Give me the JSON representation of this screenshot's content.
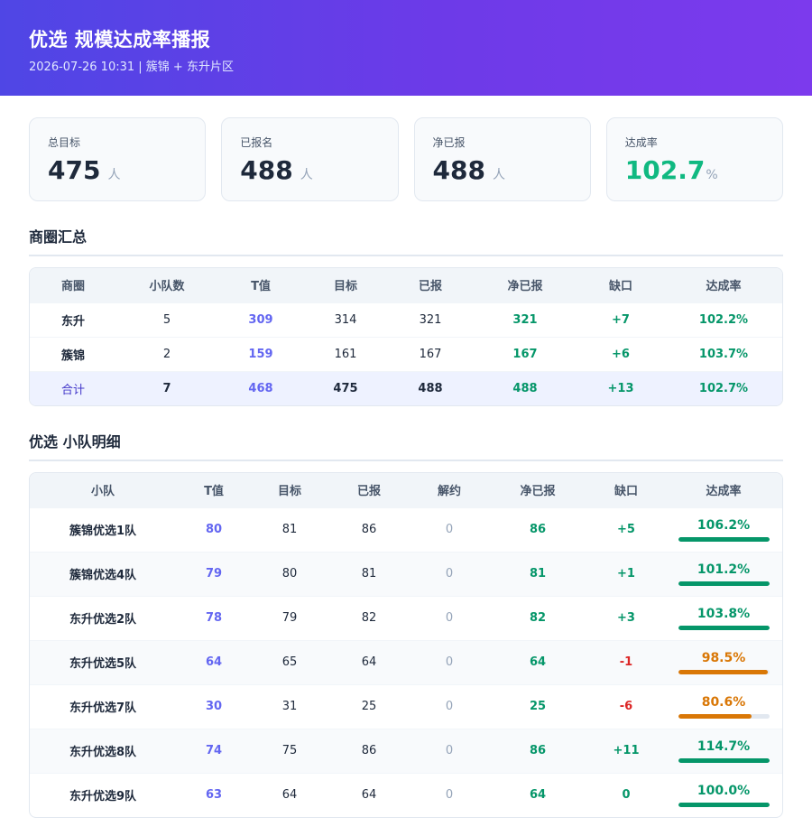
{
  "header": {
    "title": "优选 规模达成率播报",
    "subtitle": "2026-07-26 10:31 | 簇锦 + 东升片区"
  },
  "cards": [
    {
      "label": "总目标",
      "value": "475",
      "unit": "人"
    },
    {
      "label": "已报名",
      "value": "488",
      "unit": "人"
    },
    {
      "label": "净已报",
      "value": "488",
      "unit": "人"
    },
    {
      "label": "达成率",
      "value": "102.7",
      "unit": "%"
    }
  ],
  "summary": {
    "title": "商圈汇总",
    "headers": [
      "商圈",
      "小队数",
      "T值",
      "目标",
      "已报",
      "净已报",
      "缺口",
      "达成率"
    ],
    "rows": [
      {
        "name": "东升",
        "teams": "5",
        "t": "309",
        "target": "314",
        "reported": "321",
        "net": "321",
        "gap": "+7",
        "rate": "102.2%"
      },
      {
        "name": "簇锦",
        "teams": "2",
        "t": "159",
        "target": "161",
        "reported": "167",
        "net": "167",
        "gap": "+6",
        "rate": "103.7%"
      }
    ],
    "total": {
      "name": "合计",
      "teams": "7",
      "t": "468",
      "target": "475",
      "reported": "488",
      "net": "488",
      "gap": "+13",
      "rate": "102.7%"
    }
  },
  "detail": {
    "title": "优选 小队明细",
    "headers": [
      "小队",
      "T值",
      "目标",
      "已报",
      "解约",
      "净已报",
      "缺口",
      "达成率"
    ],
    "rows": [
      {
        "name": "簇锦优选1队",
        "t": "80",
        "target": "81",
        "reported": "86",
        "cancel": "0",
        "net": "86",
        "gap": "+5",
        "rate": "106.2%",
        "progress": 1.0,
        "status": "good"
      },
      {
        "name": "簇锦优选4队",
        "t": "79",
        "target": "80",
        "reported": "81",
        "cancel": "0",
        "net": "81",
        "gap": "+1",
        "rate": "101.2%",
        "progress": 1.0,
        "status": "good"
      },
      {
        "name": "东升优选2队",
        "t": "78",
        "target": "79",
        "reported": "82",
        "cancel": "0",
        "net": "82",
        "gap": "+3",
        "rate": "103.8%",
        "progress": 1.0,
        "status": "good"
      },
      {
        "name": "东升优选5队",
        "t": "64",
        "target": "65",
        "reported": "64",
        "cancel": "0",
        "net": "64",
        "gap": "-1",
        "rate": "98.5%",
        "progress": 0.985,
        "status": "warn"
      },
      {
        "name": "东升优选7队",
        "t": "30",
        "target": "31",
        "reported": "25",
        "cancel": "0",
        "net": "25",
        "gap": "-6",
        "rate": "80.6%",
        "progress": 0.806,
        "status": "warn"
      },
      {
        "name": "东升优选8队",
        "t": "74",
        "target": "75",
        "reported": "86",
        "cancel": "0",
        "net": "86",
        "gap": "+11",
        "rate": "114.7%",
        "progress": 1.0,
        "status": "good"
      },
      {
        "name": "东升优选9队",
        "t": "63",
        "target": "64",
        "reported": "64",
        "cancel": "0",
        "net": "64",
        "gap": "0",
        "rate": "100.0%",
        "progress": 1.0,
        "status": "good"
      }
    ]
  },
  "colors": {
    "good": "#059669",
    "warn": "#d97706",
    "bad": "#dc2626",
    "tvalue": "#6366f1",
    "header_gradient_start": "#4f46e5",
    "header_gradient_end": "#7c3aed"
  }
}
